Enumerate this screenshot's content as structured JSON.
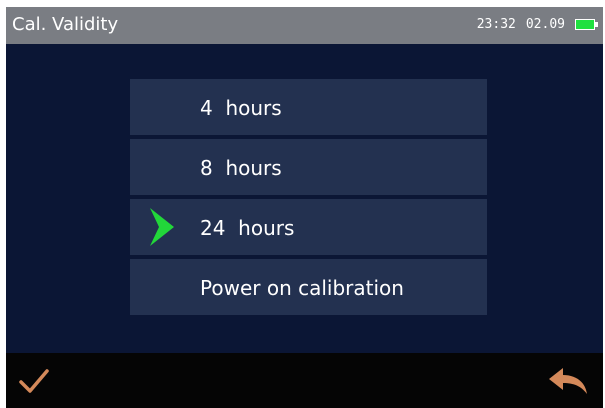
{
  "header": {
    "title": "Cal. Validity",
    "time": "23:32",
    "date": "02.09",
    "battery_icon": "battery-icon",
    "battery_color": "#20e040"
  },
  "menu": {
    "items": [
      {
        "label": "4  hours",
        "selected": false
      },
      {
        "label": "8  hours",
        "selected": false
      },
      {
        "label": "24  hours",
        "selected": true
      },
      {
        "label": "Power on calibration",
        "selected": false
      }
    ],
    "selection_icon": "arrow-right-icon",
    "selection_color": "#22d63a"
  },
  "footer": {
    "confirm_icon": "checkmark-icon",
    "back_icon": "back-arrow-icon",
    "icon_color": "#d4895a"
  }
}
